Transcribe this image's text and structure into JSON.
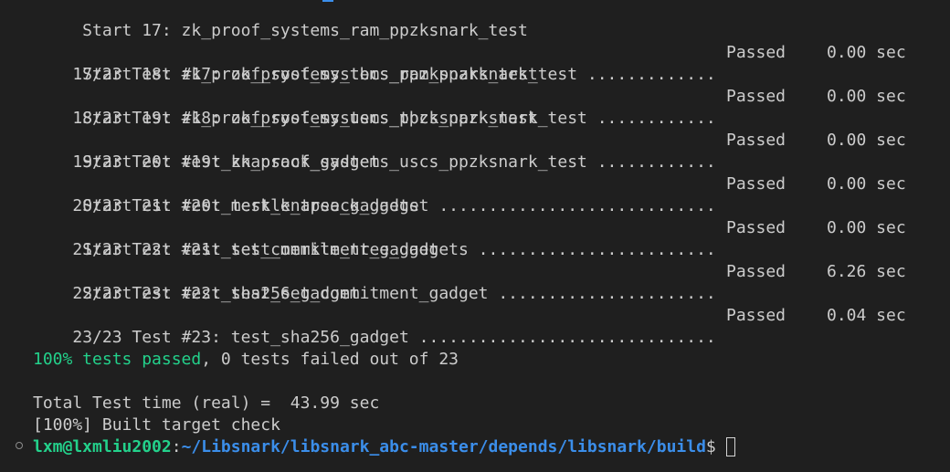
{
  "results": [
    {
      "start": "     Start 17: zk_proof_systems_ram_ppzksnark_test",
      "test": "17/23 Test #17: zk_proof_systems_ram_ppzksnark_test .............",
      "status": "Passed",
      "time": "0.00 sec"
    },
    {
      "start": "     Start 18: zk_proof_systems_tbcs_ppzksnark_test",
      "test": "18/23 Test #18: zk_proof_systems_tbcs_ppzksnark_test ............",
      "status": "Passed",
      "time": "0.00 sec"
    },
    {
      "start": "     Start 19: zk_proof_systems_uscs_ppzksnark_test",
      "test": "19/23 Test #19: zk_proof_systems_uscs_ppzksnark_test ............",
      "status": "Passed",
      "time": "0.00 sec"
    },
    {
      "start": "     Start 20: test_knapsack_gadget",
      "test": "20/23 Test #20: test_knapsack_gadget ............................",
      "status": "Passed",
      "time": "0.00 sec"
    },
    {
      "start": "     Start 21: test_merkle_tree_gadgets",
      "test": "21/23 Test #21: test_merkle_tree_gadgets ........................",
      "status": "Passed",
      "time": "0.00 sec"
    },
    {
      "start": "     Start 22: test_set_commitment_gadget",
      "test": "22/23 Test #22: test_set_commitment_gadget ......................",
      "status": "Passed",
      "time": "6.26 sec"
    },
    {
      "start": "     Start 23: test_sha256_gadget",
      "test": "23/23 Test #23: test_sha256_gadget ..............................",
      "status": "Passed",
      "time": "0.04 sec"
    }
  ],
  "summary": {
    "passed_text": "100% tests passed",
    "failed_text": ", 0 tests failed out of 23"
  },
  "total_time": "Total Test time (real) =  43.99 sec",
  "build_line": "[100%] Built target check",
  "prompt": {
    "user": "lxm@lxmliu2002",
    "colon": ":",
    "path": "~/Libsnark/libsnark_abc-master/depends/libsnark/build",
    "symbol": "$"
  },
  "colors": {
    "background": "#1f1f1f",
    "text": "#cccccc",
    "green": "#23d18b",
    "blue": "#3b8eea"
  }
}
